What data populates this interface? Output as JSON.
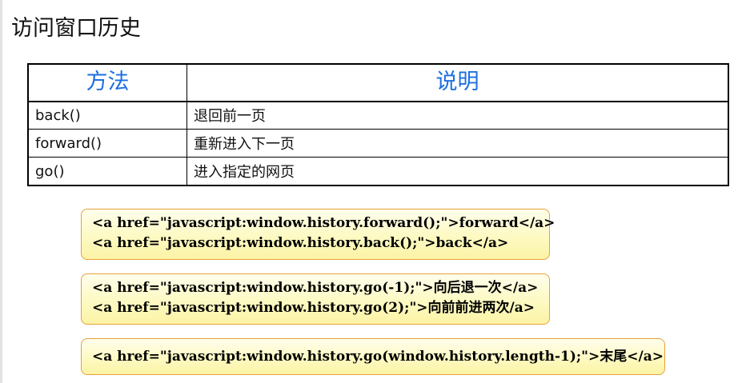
{
  "title": "访问窗口历史",
  "table": {
    "headers": [
      "方法",
      "说明"
    ],
    "rows": [
      {
        "method": "back()",
        "desc": "退回前一页"
      },
      {
        "method": "forward()",
        "desc": "重新进入下一页"
      },
      {
        "method": "go()",
        "desc": "进入指定的网页"
      }
    ]
  },
  "code_boxes": [
    {
      "lines": [
        "<a href=\"javascript:window.history.forward();\">forward</a>",
        "<a href=\"javascript:window.history.back();\">back</a>"
      ]
    },
    {
      "lines": [
        "<a href=\"javascript:window.history.go(-1);\">向后退一次</a>",
        "<a href=\"javascript:window.history.go(2);\">向前前进两次/a>"
      ]
    },
    {
      "lines": [
        "<a href=\"javascript:window.history.go(window.history.length-1);\">末尾</a>"
      ]
    }
  ],
  "colors": {
    "header_text": "#1d6fe0",
    "box_border": "#e8a13a",
    "box_fill": "#fdf9bf"
  }
}
